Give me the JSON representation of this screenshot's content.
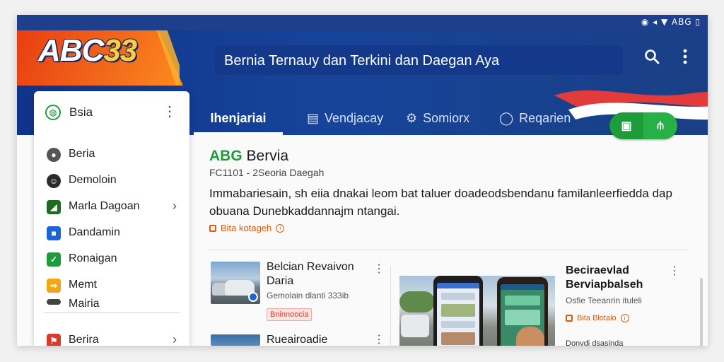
{
  "status": {
    "text": "◉ ◂ ▼ ABG ▯"
  },
  "header": {
    "logo_main": "ABC",
    "logo_accent": "33",
    "search_text": "Bernia Ternauy dan Terkini dan Daegan Aya",
    "icons": [
      "search-icon",
      "more-vert-icon"
    ]
  },
  "tabs": [
    {
      "label": "Ihenjariai",
      "icon": "",
      "active": true
    },
    {
      "label": "Vendjacay",
      "icon": "list-icon"
    },
    {
      "label": "Somiorx",
      "icon": "gear-icon"
    },
    {
      "label": "Reqarien",
      "icon": "chat-icon"
    }
  ],
  "pill": {
    "left_icon": "▣",
    "right_icon": "⫛"
  },
  "drawer": {
    "title": "Bsia",
    "items": [
      {
        "label": "Beria",
        "icon": "circle-gray-icon",
        "color": "#555555"
      },
      {
        "label": "Demoloin",
        "icon": "avatar-icon",
        "color": "#2a2a2a"
      },
      {
        "label": "Marla Dagoan",
        "icon": "green-box-icon",
        "color": "#1e6b1e",
        "chevron": true
      },
      {
        "label": "Dandamin",
        "icon": "blue-box-icon",
        "color": "#1a66d8"
      },
      {
        "label": "Ronaigan",
        "icon": "check-icon",
        "color": "#1e9b3a"
      },
      {
        "label": "Memt",
        "icon": "yellow-box-icon",
        "color": "#f2a516"
      },
      {
        "label": "Mairia",
        "icon": "dark-box-icon",
        "color": "#444444"
      }
    ],
    "footer": {
      "label": "Berira",
      "icon": "red-flag-icon",
      "color": "#d83a2e",
      "chevron": true
    }
  },
  "content": {
    "title_brand": "ABG",
    "title_rest": "Bervia",
    "subtitle": "FC1101 - 2Seoria Daegah",
    "paragraph": "Immabariesain, sh eiia dnakai leom bat taluer doadeodsbendanu familanleerfiedda dap obuana Dunebkaddannajm ntangai.",
    "link": "Bita kotageh"
  },
  "news": [
    {
      "title": "Belcian Revaivon Daria",
      "meta": "Gemolain dlanti 333ib",
      "tag": "Bninnoocia"
    },
    {
      "title": "Rueairoadie",
      "meta": "",
      "tag": ""
    }
  ],
  "feature": {
    "title": "Beciraevlad Berviapbalseh",
    "meta": "Osfie Teeanrin ituleli",
    "link": "Bita Blotalo",
    "more": "Donvdi dsasinda"
  },
  "colors": {
    "brand_blue": "#16449a",
    "brand_orange": "#f26a1b",
    "accent_green": "#1e9b3a"
  }
}
